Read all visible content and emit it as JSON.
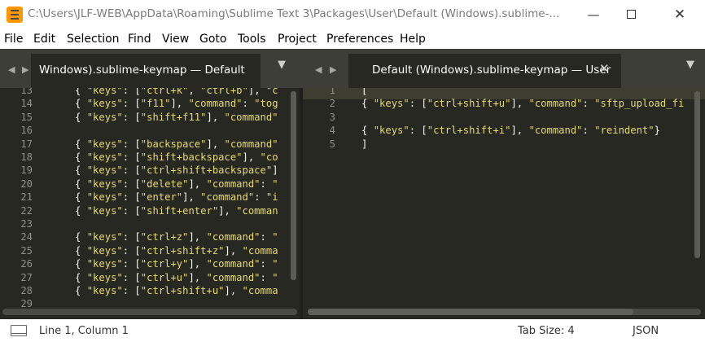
{
  "window": {
    "title": "C:\\Users\\JLF-WEB\\AppData\\Roaming\\Sublime Text 3\\Packages\\User\\Default (Windows).sublime-...",
    "minimize_glyph": "—",
    "close_glyph": "✕"
  },
  "menu": [
    "File",
    "Edit",
    "Selection",
    "Find",
    "View",
    "Goto",
    "Tools",
    "Project",
    "Preferences",
    "Help"
  ],
  "tabs": {
    "left": {
      "label": "Windows).sublime-keymap — Default"
    },
    "right": {
      "label": "Default (Windows).sublime-keymap — User",
      "close_glyph": "✕"
    },
    "nav_prev": "◀",
    "nav_next": "▶",
    "dropdown": "▼"
  },
  "left_pane": {
    "line_numbers": [
      "13",
      "14",
      "15",
      "16",
      "17",
      "18",
      "19",
      "20",
      "21",
      "22",
      "23",
      "24",
      "25",
      "26",
      "27",
      "28",
      "29"
    ],
    "lines": [
      [
        "\t{ ",
        "\"keys\"",
        ": [",
        "\"ctrl+k\"",
        ", ",
        "\"ctrl+b\"",
        "], ",
        "\"c"
      ],
      [
        "\t{ ",
        "\"keys\"",
        ": [",
        "\"f11\"",
        "], ",
        "\"command\"",
        ": ",
        "\"tog"
      ],
      [
        "\t{ ",
        "\"keys\"",
        ": [",
        "\"shift+f11\"",
        "], ",
        "\"command\""
      ],
      [],
      [
        "\t{ ",
        "\"keys\"",
        ": [",
        "\"backspace\"",
        "], ",
        "\"command\""
      ],
      [
        "\t{ ",
        "\"keys\"",
        ": [",
        "\"shift+backspace\"",
        "], ",
        "\"co"
      ],
      [
        "\t{ ",
        "\"keys\"",
        ": [",
        "\"ctrl+shift+backspace\"",
        "]"
      ],
      [
        "\t{ ",
        "\"keys\"",
        ": [",
        "\"delete\"",
        "], ",
        "\"command\"",
        ": ",
        "\""
      ],
      [
        "\t{ ",
        "\"keys\"",
        ": [",
        "\"enter\"",
        "], ",
        "\"command\"",
        ": ",
        "\"i"
      ],
      [
        "\t{ ",
        "\"keys\"",
        ": [",
        "\"shift+enter\"",
        "], ",
        "\"comman"
      ],
      [],
      [
        "\t{ ",
        "\"keys\"",
        ": [",
        "\"ctrl+z\"",
        "], ",
        "\"command\"",
        ": ",
        "\""
      ],
      [
        "\t{ ",
        "\"keys\"",
        ": [",
        "\"ctrl+shift+z\"",
        "], ",
        "\"comma"
      ],
      [
        "\t{ ",
        "\"keys\"",
        ": [",
        "\"ctrl+y\"",
        "], ",
        "\"command\"",
        ": ",
        "\""
      ],
      [
        "\t{ ",
        "\"keys\"",
        ": [",
        "\"ctrl+u\"",
        "], ",
        "\"command\"",
        ": ",
        "\""
      ],
      [
        "\t{ ",
        "\"keys\"",
        ": [",
        "\"ctrl+shift+u\"",
        "], ",
        "\"comma"
      ],
      []
    ]
  },
  "right_pane": {
    "line_numbers": [
      "1",
      "2",
      "3",
      "4",
      "5"
    ],
    "lines": [
      [
        "["
      ],
      [
        "{ ",
        "\"keys\"",
        ": [",
        "\"ctrl+shift+u\"",
        "], ",
        "\"command\"",
        ": ",
        "\"sftp_upload_fi"
      ],
      [],
      [
        "{ ",
        "\"keys\"",
        ": [",
        "\"ctrl+shift+i\"",
        "], ",
        "\"command\"",
        ": ",
        "\"reindent\"",
        "}"
      ],
      [
        "]"
      ]
    ]
  },
  "status": {
    "position": "Line 1, Column 1",
    "tab_size": "Tab Size: 4",
    "syntax": "JSON"
  },
  "colors": {
    "background": "#272822",
    "string": "#e6db74",
    "text": "#f8f8f2",
    "line_number": "#8f908a",
    "tab_bar": "#3d3e38"
  }
}
